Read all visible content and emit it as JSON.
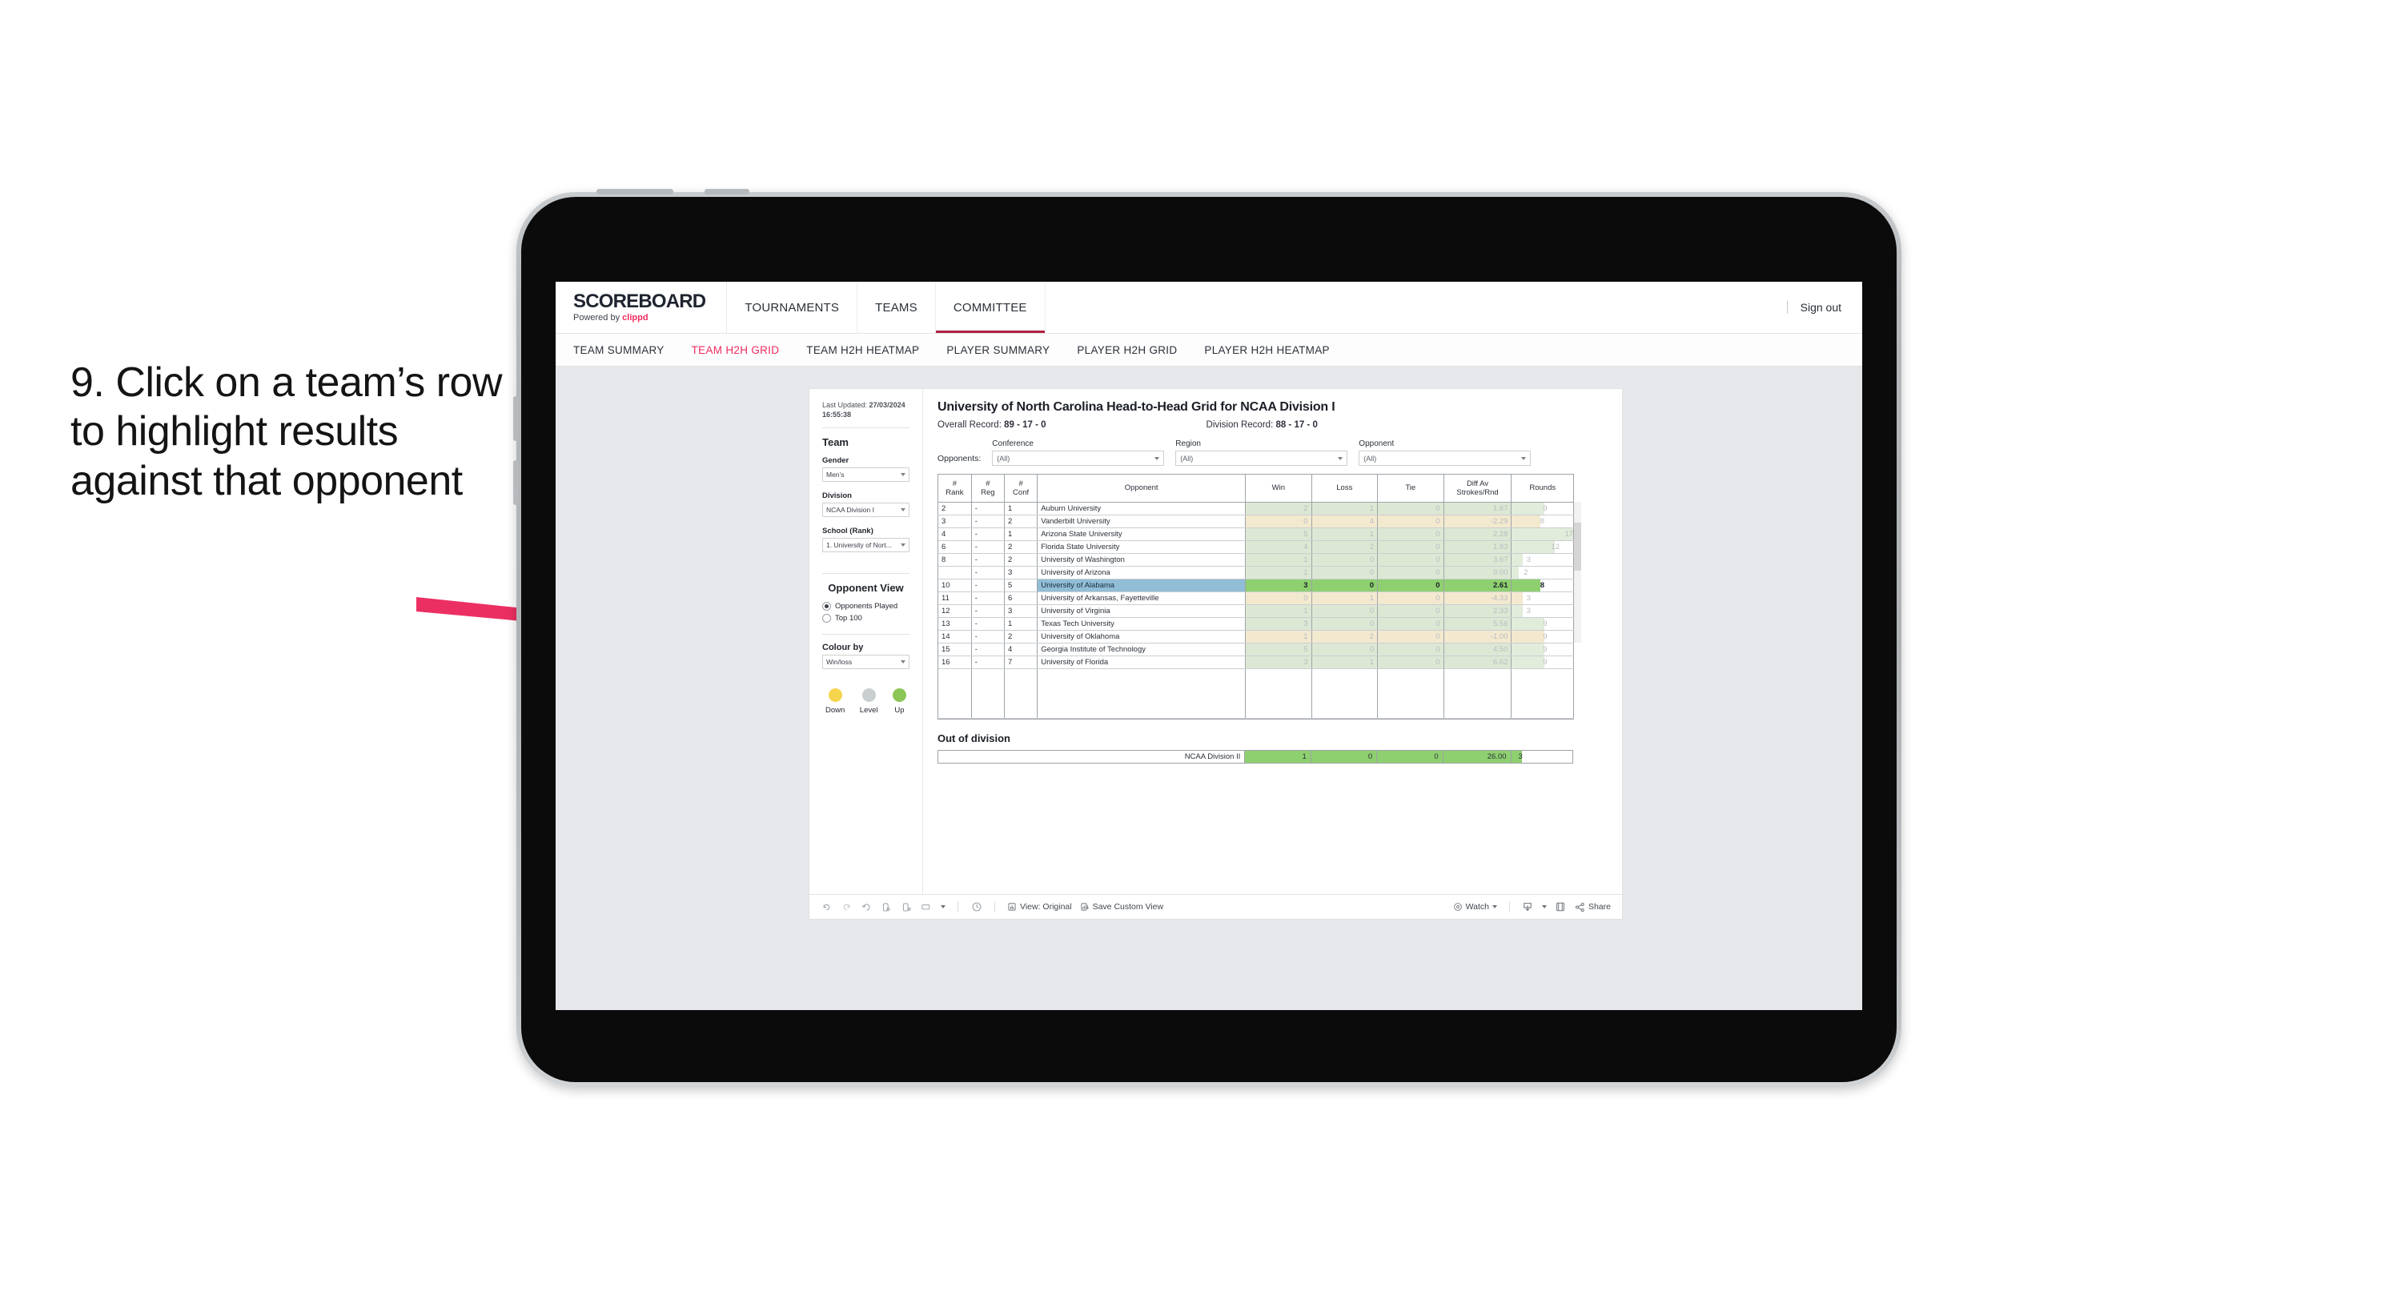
{
  "annotation": {
    "text": "9. Click on a team’s row to highlight results against that opponent",
    "arrow_color": "#ec2f63"
  },
  "topnav": {
    "brand": "SCOREBOARD",
    "brand_sub_prefix": "Powered by ",
    "brand_sub_name": "clippd",
    "items": [
      {
        "label": "TOURNAMENTS",
        "active": false
      },
      {
        "label": "TEAMS",
        "active": false
      },
      {
        "label": "COMMITTEE",
        "active": true
      }
    ],
    "signout": "Sign out"
  },
  "subnav": {
    "items": [
      {
        "label": "TEAM SUMMARY",
        "active": false
      },
      {
        "label": "TEAM H2H GRID",
        "active": true
      },
      {
        "label": "TEAM H2H HEATMAP",
        "active": false
      },
      {
        "label": "PLAYER SUMMARY",
        "active": false
      },
      {
        "label": "PLAYER H2H GRID",
        "active": false
      },
      {
        "label": "PLAYER H2H HEATMAP",
        "active": false
      }
    ]
  },
  "sidebar": {
    "last_updated_label": "Last Updated: ",
    "last_updated_value": "27/03/2024 16:55:38",
    "team_heading": "Team",
    "gender_label": "Gender",
    "gender_value": "Men’s",
    "division_label": "Division",
    "division_value": "NCAA Division I",
    "school_label": "School (Rank)",
    "school_value": "1. University of Nort...",
    "opponent_view_heading": "Opponent View",
    "opponent_view_options": [
      {
        "label": "Opponents Played",
        "selected": true
      },
      {
        "label": "Top 100",
        "selected": false
      }
    ],
    "colour_by_label": "Colour by",
    "colour_by_value": "Win/loss",
    "legend": [
      {
        "label": "Down",
        "color": "#f5d44e"
      },
      {
        "label": "Level",
        "color": "#c9ced1"
      },
      {
        "label": "Up",
        "color": "#8cc657"
      }
    ]
  },
  "main": {
    "title": "University of North Carolina Head-to-Head Grid for NCAA Division I",
    "overall_record_label": "Overall Record: ",
    "overall_record_value": "89 - 17 - 0",
    "division_record_label": "Division Record: ",
    "division_record_value": "88 - 17 - 0",
    "opponents_label": "Opponents:",
    "filters": [
      {
        "label": "Conference",
        "value": "(All)"
      },
      {
        "label": "Region",
        "value": "(All)"
      },
      {
        "label": "Opponent",
        "value": "(All)"
      }
    ],
    "out_of_division_heading": "Out of division"
  },
  "chart_data": {
    "type": "table",
    "title": "University of North Carolina Head-to-Head Grid for NCAA Division I",
    "columns": [
      "# Rank",
      "# Reg",
      "# Conf",
      "Opponent",
      "Win",
      "Loss",
      "Tie",
      "Diff Av Strokes/Rnd",
      "Rounds"
    ],
    "rounds_max": 17,
    "colors": {
      "win_dim": "#dde8d4",
      "loss_dim": "#f3e9cf",
      "win_strong": "#8ed06f",
      "selected_opponent": "#92bdd6",
      "rounds_bar_dim": "#e2ecdb",
      "rounds_bar_dim_loss": "#f3e9cf",
      "rounds_bar_strong": "#8ed06f"
    },
    "rows": [
      {
        "rank": "2",
        "reg": "-",
        "conf": "1",
        "opponent": "Auburn University",
        "win": "2",
        "loss": "1",
        "tie": "0",
        "diff": "1.67",
        "rounds": "9",
        "result": "win",
        "selected": false
      },
      {
        "rank": "3",
        "reg": "-",
        "conf": "2",
        "opponent": "Vanderbilt University",
        "win": "0",
        "loss": "4",
        "tie": "0",
        "diff": "-2.29",
        "rounds": "8",
        "result": "loss",
        "selected": false
      },
      {
        "rank": "4",
        "reg": "-",
        "conf": "1",
        "opponent": "Arizona State University",
        "win": "5",
        "loss": "1",
        "tie": "0",
        "diff": "2.28",
        "rounds": "17",
        "result": "win",
        "selected": false
      },
      {
        "rank": "6",
        "reg": "-",
        "conf": "2",
        "opponent": "Florida State University",
        "win": "4",
        "loss": "2",
        "tie": "0",
        "diff": "1.83",
        "rounds": "12",
        "result": "win",
        "selected": false
      },
      {
        "rank": "8",
        "reg": "-",
        "conf": "2",
        "opponent": "University of Washington",
        "win": "1",
        "loss": "0",
        "tie": "0",
        "diff": "3.67",
        "rounds": "3",
        "result": "win",
        "selected": false
      },
      {
        "rank": "",
        "reg": "-",
        "conf": "3",
        "opponent": "University of Arizona",
        "win": "1",
        "loss": "0",
        "tie": "0",
        "diff": "9.00",
        "rounds": "2",
        "result": "win",
        "selected": false
      },
      {
        "rank": "10",
        "reg": "-",
        "conf": "5",
        "opponent": "University of Alabama",
        "win": "3",
        "loss": "0",
        "tie": "0",
        "diff": "2.61",
        "rounds": "8",
        "result": "win",
        "selected": true
      },
      {
        "rank": "11",
        "reg": "-",
        "conf": "6",
        "opponent": "University of Arkansas, Fayetteville",
        "win": "0",
        "loss": "1",
        "tie": "0",
        "diff": "-4.33",
        "rounds": "3",
        "result": "loss",
        "selected": false
      },
      {
        "rank": "12",
        "reg": "-",
        "conf": "3",
        "opponent": "University of Virginia",
        "win": "1",
        "loss": "0",
        "tie": "0",
        "diff": "2.33",
        "rounds": "3",
        "result": "win",
        "selected": false
      },
      {
        "rank": "13",
        "reg": "-",
        "conf": "1",
        "opponent": "Texas Tech University",
        "win": "3",
        "loss": "0",
        "tie": "0",
        "diff": "5.56",
        "rounds": "9",
        "result": "win",
        "selected": false
      },
      {
        "rank": "14",
        "reg": "-",
        "conf": "2",
        "opponent": "University of Oklahoma",
        "win": "1",
        "loss": "2",
        "tie": "0",
        "diff": "-1.00",
        "rounds": "9",
        "result": "loss",
        "selected": false
      },
      {
        "rank": "15",
        "reg": "-",
        "conf": "4",
        "opponent": "Georgia Institute of Technology",
        "win": "5",
        "loss": "0",
        "tie": "0",
        "diff": "4.50",
        "rounds": "9",
        "result": "win",
        "selected": false
      },
      {
        "rank": "16",
        "reg": "-",
        "conf": "7",
        "opponent": "University of Florida",
        "win": "3",
        "loss": "1",
        "tie": "0",
        "diff": "6.62",
        "rounds": "9",
        "result": "win",
        "selected": false
      }
    ],
    "out_of_division": {
      "name": "NCAA Division II",
      "win": "1",
      "loss": "0",
      "tie": "0",
      "diff": "26.00",
      "rounds": "3"
    }
  },
  "toolbar": {
    "view_label": "View: Original",
    "save_custom_view": "Save Custom View",
    "watch": "Watch",
    "share": "Share"
  }
}
